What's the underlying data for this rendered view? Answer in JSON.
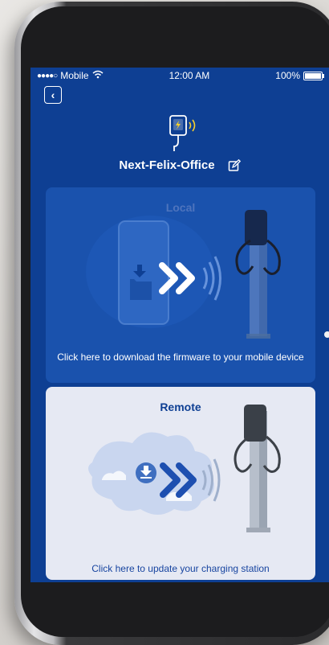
{
  "status_bar": {
    "carrier": "Mobile",
    "time": "12:00 AM",
    "battery": "100%"
  },
  "header": {
    "device_name": "Next-Felix-Office"
  },
  "cards": {
    "local": {
      "title": "Local",
      "description": "Click here to download the firmware to your mobile device"
    },
    "remote": {
      "title": "Remote",
      "description": "Click here to update your charging station"
    }
  },
  "icons": {
    "back": "chevron-left-icon",
    "charger": "charger-icon",
    "edit": "edit-icon",
    "download": "download-icon",
    "arrows": "double-chevron-right-icon",
    "signal": "signal-waves-icon"
  },
  "colors": {
    "screen_bg": "#0e3f93",
    "local_card": "#1a52ad",
    "remote_card": "#e6e9f3",
    "remote_text": "#1845a0"
  }
}
